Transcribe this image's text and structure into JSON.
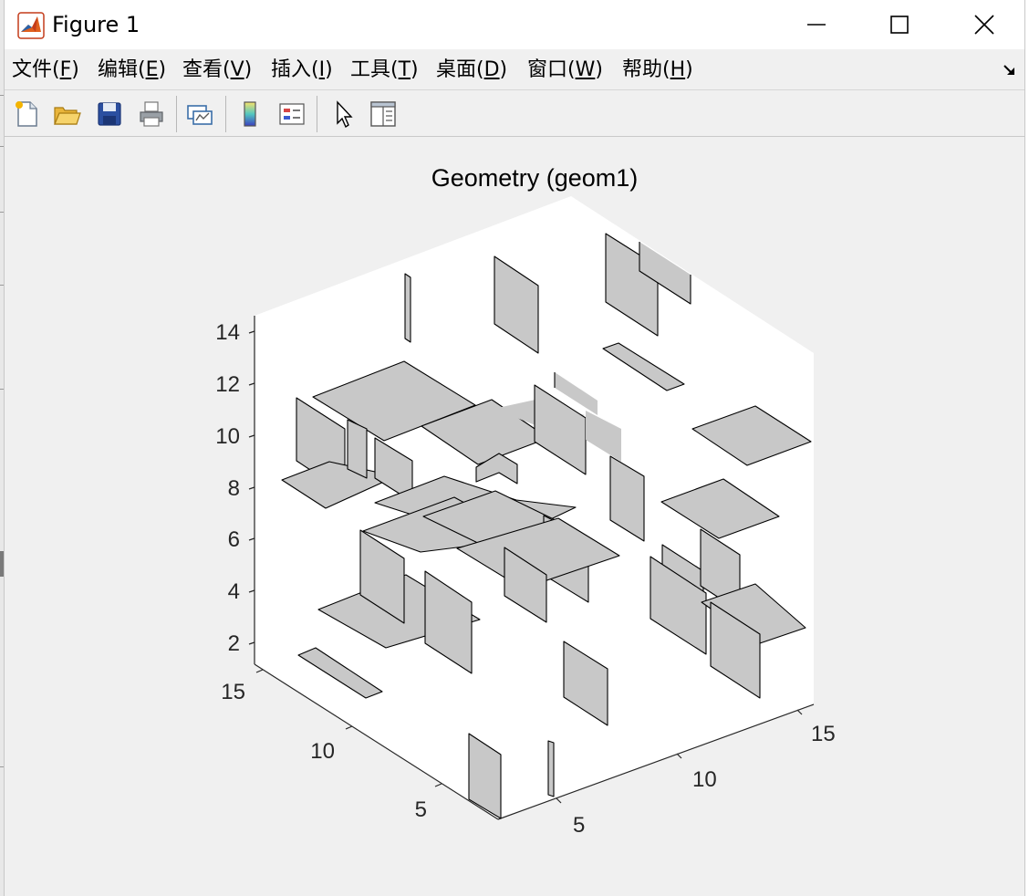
{
  "window": {
    "title": "Figure 1",
    "icon": "matlab-logo-icon",
    "controls": [
      "minimize-icon",
      "maximize-icon",
      "close-icon"
    ]
  },
  "menu": [
    {
      "prefix": "文件(",
      "accel": "F",
      "suffix": ")"
    },
    {
      "prefix": "编辑(",
      "accel": "E",
      "suffix": ")"
    },
    {
      "prefix": "查看(",
      "accel": "V",
      "suffix": ")"
    },
    {
      "prefix": "插入(",
      "accel": "I",
      "suffix": ")"
    },
    {
      "prefix": "工具(",
      "accel": "T",
      "suffix": ")"
    },
    {
      "prefix": "桌面(",
      "accel": "D",
      "suffix": ")"
    },
    {
      "prefix": "窗口(",
      "accel": "W",
      "suffix": ")"
    },
    {
      "prefix": "帮助(",
      "accel": "H",
      "suffix": ")"
    }
  ],
  "toolbar": {
    "buttons": [
      "new-figure-icon",
      "open-file-icon",
      "save-icon",
      "print-icon",
      "link-plot-icon",
      "insert-colorbar-icon",
      "insert-legend-icon",
      "edit-plot-arrow-icon",
      "property-inspector-icon"
    ]
  },
  "plot": {
    "title": "Geometry (geom1)",
    "z_ticks": [
      "14",
      "12",
      "10",
      "8",
      "6",
      "4",
      "2"
    ],
    "y_ticks": [
      "15",
      "10",
      "5"
    ],
    "x_ticks": [
      "5",
      "10",
      "15"
    ],
    "face_color": "#c8c8c8",
    "edge_color": "#000000"
  },
  "colors": {
    "window_bg": "#f0f0f0",
    "titlebar_bg": "#ffffff",
    "axes_bg": "#ffffff",
    "text": "#000000"
  }
}
